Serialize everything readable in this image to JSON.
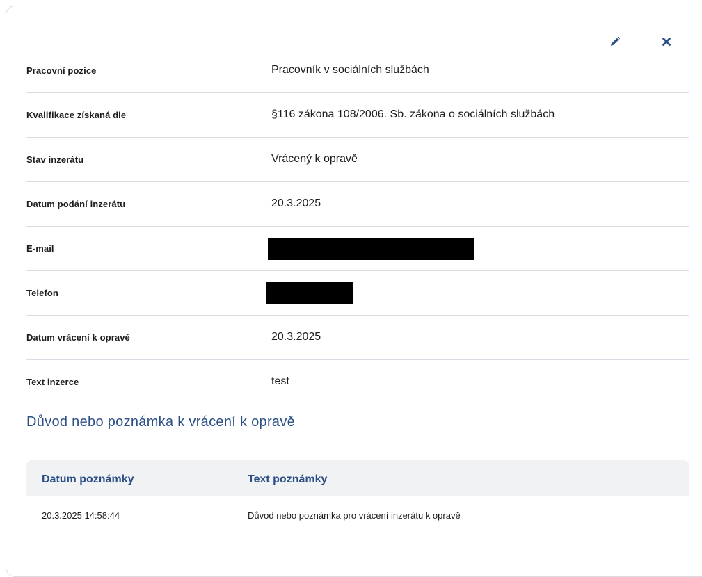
{
  "detail": {
    "rows": [
      {
        "label": "Pracovní pozice",
        "value": "Pracovník v sociálních službách"
      },
      {
        "label": "Kvalifikace získaná dle",
        "value": "§116 zákona 108/2006. Sb. zákona o sociálních službách"
      },
      {
        "label": "Stav inzerátu",
        "value": "Vrácený k opravě"
      },
      {
        "label": "Datum podání inzerátu",
        "value": "20.3.2025"
      },
      {
        "label": "E-mail",
        "value": ""
      },
      {
        "label": "Telefon",
        "value": ""
      },
      {
        "label": "Datum vrácení k opravě",
        "value": "20.3.2025"
      },
      {
        "label": "Text inzerce",
        "value": "test"
      }
    ]
  },
  "notes": {
    "title": "Důvod nebo poznámka k vrácení k opravě",
    "headers": {
      "date": "Datum poznámky",
      "text": "Text poznámky"
    },
    "rows": [
      {
        "date": "20.3.2025 14:58:44",
        "text": "Důvod nebo poznámka pro vrácení inzerátu k opravě"
      }
    ]
  },
  "icons": {
    "edit": "pencil-icon",
    "close": "close-icon"
  },
  "colors": {
    "accent": "#2b4f86",
    "divider": "#d9dde3",
    "table_header_bg": "#f1f2f4",
    "text": "#1d1d1d"
  }
}
